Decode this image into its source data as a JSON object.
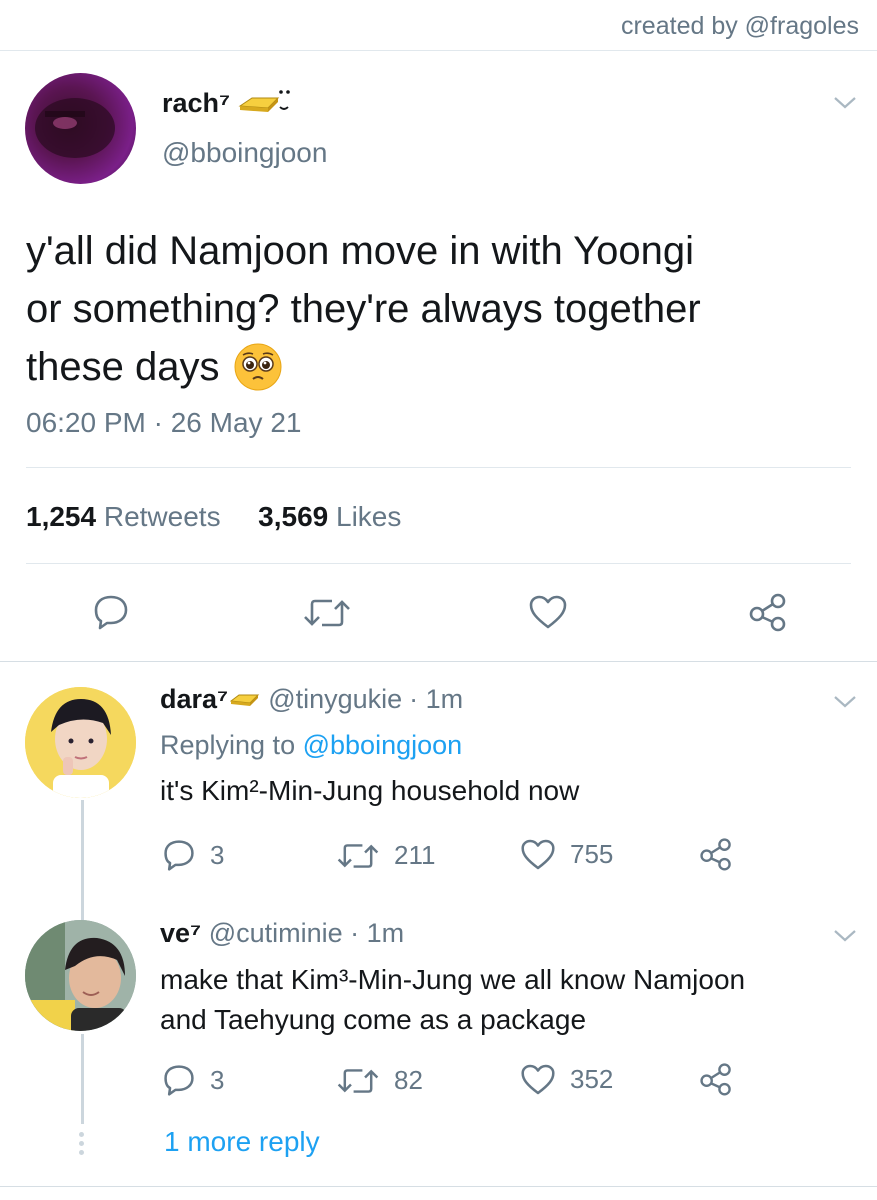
{
  "credit": "created by @fragoles",
  "main_tweet": {
    "display_name": "rach⁷",
    "handle": "@bboingjoon",
    "text_line1": "y'all did Namjoon move in with Yoongi",
    "text_line2": "or something? they're always together",
    "text_line3": "these days",
    "timestamp": "06:20 PM · 26 May 21",
    "retweet_count": "1,254",
    "retweet_label": "Retweets",
    "like_count": "3,569",
    "like_label": "Likes"
  },
  "replies": [
    {
      "display_name": "dara⁷",
      "handle": "@tinygukie",
      "time": "· 1m",
      "replying_prefix": "Replying to",
      "replying_to": "@bboingjoon",
      "text_line1": "it's Kim²-Min-Jung household now",
      "reply_count": "3",
      "retweet_count": "211",
      "like_count": "755"
    },
    {
      "display_name": "ve⁷",
      "handle": "@cutiminie",
      "time": "· 1m",
      "text_line1": "make that Kim³-Min-Jung we all know Namjoon",
      "text_line2": "and Taehyung come as a package",
      "reply_count": "3",
      "retweet_count": "82",
      "like_count": "352"
    }
  ],
  "more_replies": "1 more reply",
  "colors": {
    "text": "#14171a",
    "muted": "#657786",
    "link": "#1da1f2",
    "divider": "#e1e8ed"
  },
  "icons": {
    "reply": "speech-bubble-icon",
    "retweet": "retweet-arrows-icon",
    "like": "heart-icon",
    "share": "share-nodes-icon",
    "menu": "chevron-down-icon",
    "emoji": "pleading-face-emoji"
  }
}
